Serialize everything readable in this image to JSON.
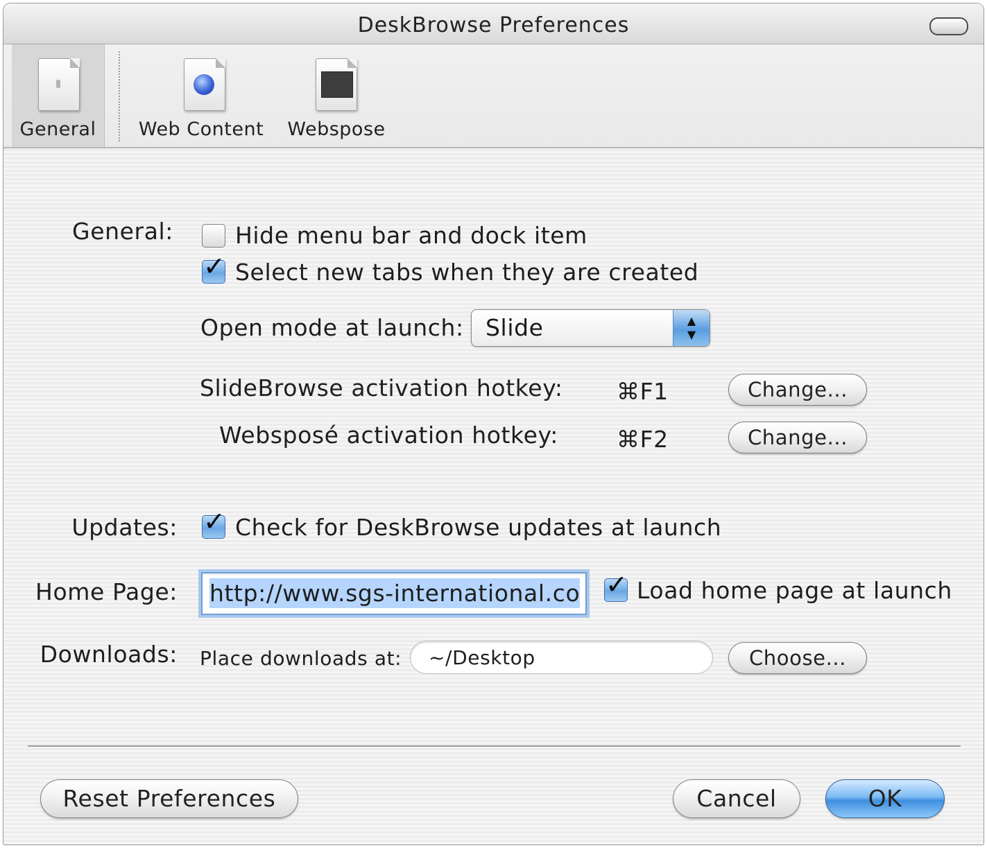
{
  "window": {
    "title": "DeskBrowse Preferences"
  },
  "toolbar": {
    "items": [
      {
        "label": "General",
        "icon": "general-doc-icon",
        "selected": true
      },
      {
        "label": "Web Content",
        "icon": "globe-doc-icon",
        "selected": false
      },
      {
        "label": "Webspose",
        "icon": "webspose-doc-icon",
        "selected": false
      }
    ]
  },
  "general": {
    "section_label": "General:",
    "hide_menu_bar": {
      "label": "Hide menu bar and dock item",
      "checked": false
    },
    "select_new_tabs": {
      "label": "Select new tabs when they are created",
      "checked": true
    },
    "open_mode": {
      "label": "Open mode at launch:",
      "value": "Slide"
    },
    "slidebrowse_hotkey": {
      "label": "SlideBrowse activation hotkey:",
      "value": "⌘F1",
      "button": "Change..."
    },
    "webspose_hotkey": {
      "label": "Websposé activation hotkey:",
      "value": "⌘F2",
      "button": "Change..."
    }
  },
  "updates": {
    "section_label": "Updates:",
    "check_updates": {
      "label": "Check for DeskBrowse updates at launch",
      "checked": true
    }
  },
  "home_page": {
    "section_label": "Home Page:",
    "url": "http://www.sgs-international.co",
    "load_at_launch": {
      "label": "Load home page at launch",
      "checked": true
    }
  },
  "downloads": {
    "section_label": "Downloads:",
    "place_label": "Place downloads at:",
    "path": "~/Desktop",
    "button": "Choose..."
  },
  "footer": {
    "reset": "Reset Preferences",
    "cancel": "Cancel",
    "ok": "OK"
  },
  "colors": {
    "accent": "#5a9de0",
    "selection": "#b5d5fd"
  }
}
